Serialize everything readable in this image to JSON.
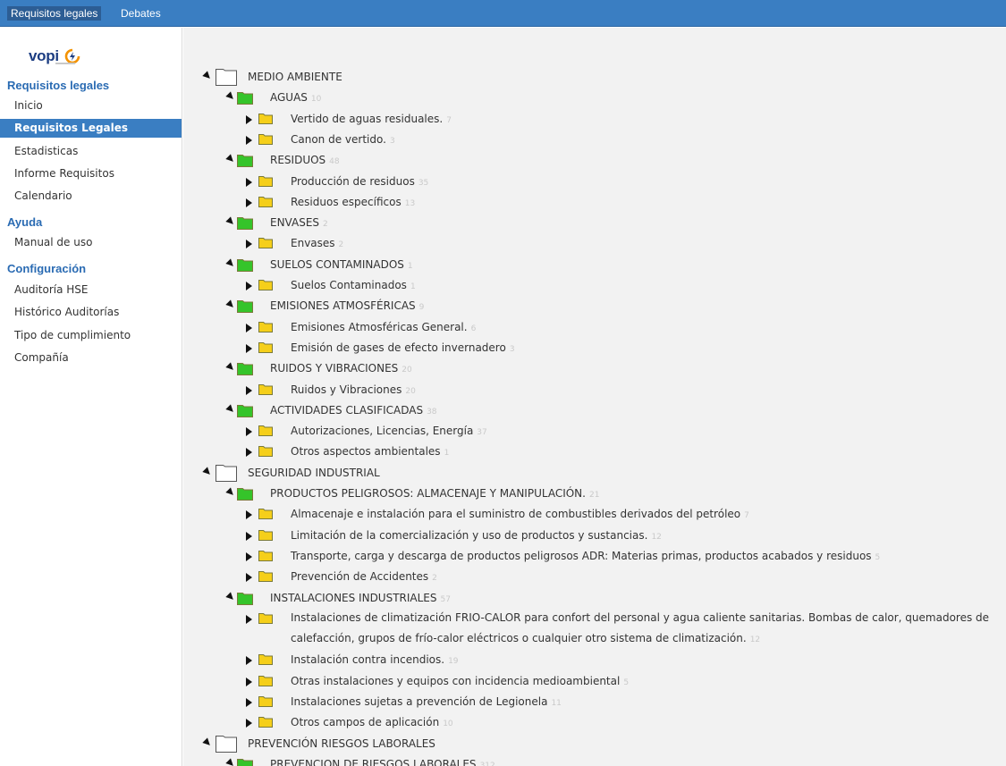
{
  "topbar": {
    "tabs": [
      "Requisitos legales",
      "Debates"
    ]
  },
  "sidebar": {
    "logo": "vopi",
    "sections": [
      {
        "title": "Requisitos legales",
        "items": [
          "Inicio",
          "Requisitos Legales",
          "Estadisticas",
          "Informe Requisitos",
          "Calendario"
        ],
        "active": 1
      },
      {
        "title": "Ayuda",
        "items": [
          "Manual de uso"
        ]
      },
      {
        "title": "Configuración",
        "items": [
          "Auditoría HSE",
          "Histórico Auditorías",
          "Tipo de cumplimiento",
          "Compañía"
        ]
      }
    ]
  },
  "tree": [
    {
      "level": 0,
      "label": "MEDIO AMBIENTE",
      "count": ""
    },
    {
      "level": 1,
      "label": "AGUAS",
      "count": "10"
    },
    {
      "level": 2,
      "label": "Vertido de aguas residuales.",
      "count": "7"
    },
    {
      "level": 2,
      "label": "Canon de vertido.",
      "count": "3"
    },
    {
      "level": 1,
      "label": "RESIDUOS",
      "count": "48"
    },
    {
      "level": 2,
      "label": "Producción de residuos",
      "count": "35"
    },
    {
      "level": 2,
      "label": "Residuos específicos",
      "count": "13"
    },
    {
      "level": 1,
      "label": "ENVASES",
      "count": "2"
    },
    {
      "level": 2,
      "label": "Envases",
      "count": "2"
    },
    {
      "level": 1,
      "label": "SUELOS CONTAMINADOS",
      "count": "1"
    },
    {
      "level": 2,
      "label": "Suelos Contaminados",
      "count": "1"
    },
    {
      "level": 1,
      "label": "EMISIONES ATMOSFÉRICAS",
      "count": "9"
    },
    {
      "level": 2,
      "label": "Emisiones Atmosféricas General.",
      "count": "6"
    },
    {
      "level": 2,
      "label": "Emisión de gases de efecto invernadero",
      "count": "3"
    },
    {
      "level": 1,
      "label": "RUIDOS Y VIBRACIONES",
      "count": "20"
    },
    {
      "level": 2,
      "label": "Ruidos y Vibraciones",
      "count": "20"
    },
    {
      "level": 1,
      "label": "ACTIVIDADES CLASIFICADAS",
      "count": "38"
    },
    {
      "level": 2,
      "label": "Autorizaciones, Licencias, Energía",
      "count": "37"
    },
    {
      "level": 2,
      "label": "Otros aspectos ambientales",
      "count": "1"
    },
    {
      "level": 0,
      "label": "SEGURIDAD INDUSTRIAL",
      "count": ""
    },
    {
      "level": 1,
      "label": "PRODUCTOS PELIGROSOS: ALMACENAJE Y MANIPULACIÓN.",
      "count": "21"
    },
    {
      "level": 2,
      "label": "Almacenaje e instalación para el suministro de combustibles derivados del petróleo",
      "count": "7"
    },
    {
      "level": 2,
      "label": "Limitación de la comercialización y uso de productos y sustancias.",
      "count": "12"
    },
    {
      "level": 2,
      "label": "Transporte, carga y descarga de productos peligrosos ADR: Materias primas, productos acabados y residuos",
      "count": "5"
    },
    {
      "level": 2,
      "label": "Prevención de Accidentes",
      "count": "2"
    },
    {
      "level": 1,
      "label": "INSTALACIONES INDUSTRIALES",
      "count": "57"
    },
    {
      "level": 2,
      "label": "Instalaciones de climatización FRIO-CALOR para confort del personal y agua caliente sanitarias. Bombas de calor, quemadores de",
      "label2": "calefacción, grupos de frío-calor eléctricos o cualquier otro sistema de climatización.",
      "count": "12"
    },
    {
      "level": 2,
      "label": "Instalación contra incendios.",
      "count": "19"
    },
    {
      "level": 2,
      "label": "Otras instalaciones y equipos con incidencia medioambiental",
      "count": "5"
    },
    {
      "level": 2,
      "label": "Instalaciones sujetas a prevención de Legionela",
      "count": "11"
    },
    {
      "level": 2,
      "label": "Otros campos de aplicación",
      "count": "10"
    },
    {
      "level": 0,
      "label": "PREVENCIÓN RIESGOS LABORALES",
      "count": ""
    },
    {
      "level": 1,
      "label": "PREVENCION DE RIESGOS LABORALES",
      "count": "312"
    }
  ],
  "colors": {
    "accent": "#3a7ec2",
    "folder_green": "#35c42a",
    "folder_yellow": "#f5cf1a",
    "folder_white": "#ffffff"
  }
}
